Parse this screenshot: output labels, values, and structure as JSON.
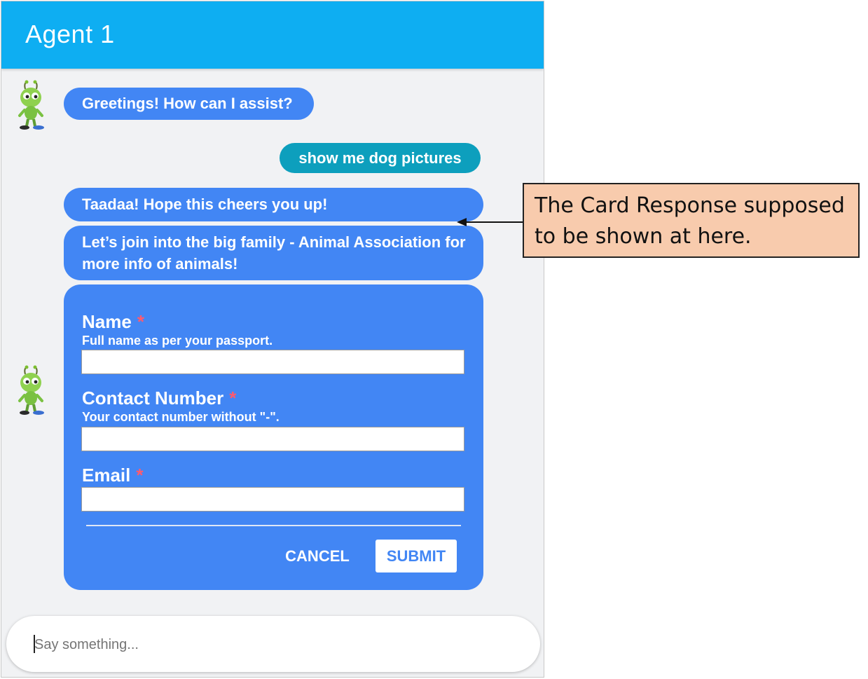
{
  "chat": {
    "title": "Agent 1",
    "messages": {
      "greeting": "Greetings! How can I assist?",
      "user": "show me dog pictures",
      "taadaa": "Taadaa! Hope this cheers you up!",
      "join": "Let’s join into the big family - Animal Association for more info of animals!"
    },
    "form": {
      "fields": [
        {
          "label": "Name",
          "required_mark": "*",
          "hint": "Full name as per your passport."
        },
        {
          "label": "Contact Number",
          "required_mark": "*",
          "hint": "Your contact number without \"-\"."
        },
        {
          "label": "Email",
          "required_mark": "*",
          "hint": ""
        }
      ],
      "cancel_label": "CANCEL",
      "submit_label": "SUBMIT"
    },
    "input": {
      "placeholder": "Say something..."
    }
  },
  "annotation": {
    "line1": "The Card Response supposed",
    "line2": "to be shown at here."
  },
  "colors": {
    "header": "#0eaef2",
    "bot_bubble": "#4286f4",
    "user_bubble": "#0d9fbd",
    "callout_fill": "#f8cbad",
    "required": "#ff5a6e"
  },
  "icons": {
    "avatar": "green-alien-robot-icon"
  }
}
